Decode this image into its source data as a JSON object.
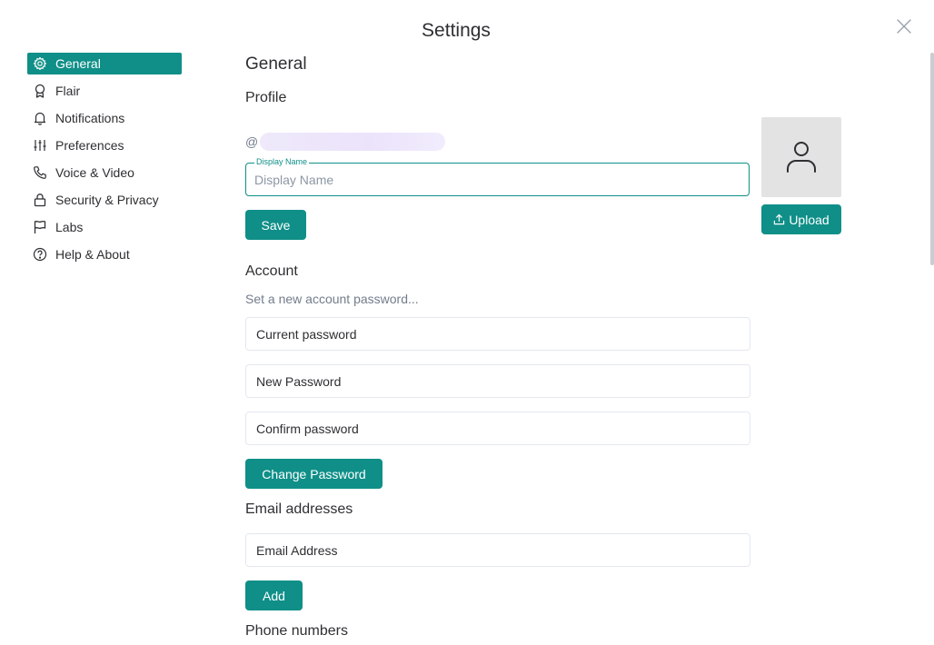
{
  "dialog": {
    "title": "Settings"
  },
  "sidebar": {
    "items": [
      {
        "label": "General",
        "icon": "gear-icon",
        "active": true
      },
      {
        "label": "Flair",
        "icon": "ribbon-icon"
      },
      {
        "label": "Notifications",
        "icon": "bell-icon"
      },
      {
        "label": "Preferences",
        "icon": "sliders-icon"
      },
      {
        "label": "Voice & Video",
        "icon": "phone-icon"
      },
      {
        "label": "Security & Privacy",
        "icon": "lock-icon"
      },
      {
        "label": "Labs",
        "icon": "flag-icon"
      },
      {
        "label": "Help & About",
        "icon": "help-circle-icon"
      }
    ]
  },
  "main": {
    "title": "General",
    "profile": {
      "heading": "Profile",
      "at_symbol": "@",
      "display_name_label": "Display Name",
      "display_name_placeholder": "Display Name",
      "save_label": "Save",
      "upload_label": "Upload"
    },
    "account": {
      "heading": "Account",
      "hint": "Set a new account password...",
      "current_password_placeholder": "Current password",
      "new_password_placeholder": "New Password",
      "confirm_password_placeholder": "Confirm password",
      "change_password_label": "Change Password"
    },
    "email": {
      "heading": "Email addresses",
      "email_placeholder": "Email Address",
      "add_label": "Add"
    },
    "phone": {
      "heading": "Phone numbers"
    }
  },
  "colors": {
    "accent": "#0f8f88",
    "muted_text": "#737d8c",
    "border": "#e3e8f0"
  }
}
